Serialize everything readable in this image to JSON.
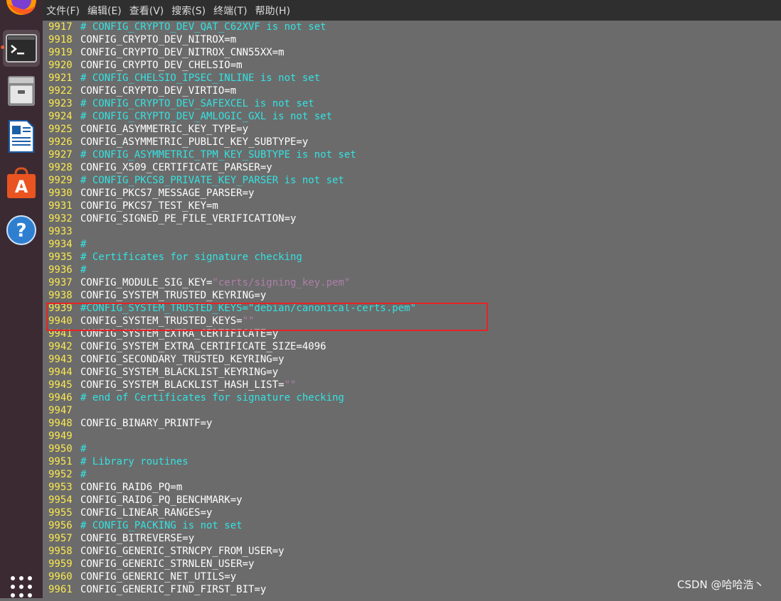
{
  "dock": {
    "items": [
      {
        "name": "firefox-icon"
      },
      {
        "name": "terminal-icon"
      },
      {
        "name": "file-cabinet-icon"
      },
      {
        "name": "writer-document-icon"
      },
      {
        "name": "software-store-icon"
      },
      {
        "name": "help-icon"
      },
      {
        "name": "show-applications-icon"
      }
    ],
    "accent": "#e95420",
    "background": "#3c2a33"
  },
  "menubar": {
    "items": [
      "文件(F)",
      "编辑(E)",
      "查看(V)",
      "搜索(S)",
      "终端(T)",
      "帮助(H)"
    ]
  },
  "colors": {
    "background": "#6b6b6b",
    "line_number": "#fce94f",
    "comment": "#34e2e2",
    "string": "#ad7fa8",
    "text": "#ffffff",
    "highlight_box": "#e82323"
  },
  "editor": {
    "lines": [
      {
        "num": "9917",
        "segments": [
          {
            "t": "# CONFIG_CRYPTO_DEV_QAT_C62XVF is not set",
            "c": "comment"
          }
        ]
      },
      {
        "num": "9918",
        "segments": [
          {
            "t": "CONFIG_CRYPTO_DEV_NITROX=m",
            "c": "text"
          }
        ]
      },
      {
        "num": "9919",
        "segments": [
          {
            "t": "CONFIG_CRYPTO_DEV_NITROX_CNN55XX=m",
            "c": "text"
          }
        ]
      },
      {
        "num": "9920",
        "segments": [
          {
            "t": "CONFIG_CRYPTO_DEV_CHELSIO=m",
            "c": "text"
          }
        ]
      },
      {
        "num": "9921",
        "segments": [
          {
            "t": "# CONFIG_CHELSIO_IPSEC_INLINE is not set",
            "c": "comment"
          }
        ]
      },
      {
        "num": "9922",
        "segments": [
          {
            "t": "CONFIG_CRYPTO_DEV_VIRTIO=m",
            "c": "text"
          }
        ]
      },
      {
        "num": "9923",
        "segments": [
          {
            "t": "# CONFIG_CRYPTO_DEV_SAFEXCEL is not set",
            "c": "comment"
          }
        ]
      },
      {
        "num": "9924",
        "segments": [
          {
            "t": "# CONFIG_CRYPTO_DEV_AMLOGIC_GXL is not set",
            "c": "comment"
          }
        ]
      },
      {
        "num": "9925",
        "segments": [
          {
            "t": "CONFIG_ASYMMETRIC_KEY_TYPE=y",
            "c": "text"
          }
        ]
      },
      {
        "num": "9926",
        "segments": [
          {
            "t": "CONFIG_ASYMMETRIC_PUBLIC_KEY_SUBTYPE=y",
            "c": "text"
          }
        ]
      },
      {
        "num": "9927",
        "segments": [
          {
            "t": "# CONFIG_ASYMMETRIC_TPM_KEY_SUBTYPE is not set",
            "c": "comment"
          }
        ]
      },
      {
        "num": "9928",
        "segments": [
          {
            "t": "CONFIG_X509_CERTIFICATE_PARSER=y",
            "c": "text"
          }
        ]
      },
      {
        "num": "9929",
        "segments": [
          {
            "t": "# CONFIG_PKCS8_PRIVATE_KEY_PARSER is not set",
            "c": "comment"
          }
        ]
      },
      {
        "num": "9930",
        "segments": [
          {
            "t": "CONFIG_PKCS7_MESSAGE_PARSER=y",
            "c": "text"
          }
        ]
      },
      {
        "num": "9931",
        "segments": [
          {
            "t": "CONFIG_PKCS7_TEST_KEY=m",
            "c": "text"
          }
        ]
      },
      {
        "num": "9932",
        "segments": [
          {
            "t": "CONFIG_SIGNED_PE_FILE_VERIFICATION=y",
            "c": "text"
          }
        ]
      },
      {
        "num": "9933",
        "segments": []
      },
      {
        "num": "9934",
        "segments": [
          {
            "t": "#",
            "c": "comment"
          }
        ]
      },
      {
        "num": "9935",
        "segments": [
          {
            "t": "# Certificates for signature checking",
            "c": "comment"
          }
        ]
      },
      {
        "num": "9936",
        "segments": [
          {
            "t": "#",
            "c": "comment"
          }
        ]
      },
      {
        "num": "9937",
        "segments": [
          {
            "t": "CONFIG_MODULE_SIG_KEY=",
            "c": "text"
          },
          {
            "t": "\"certs/signing_key.pem\"",
            "c": "string"
          }
        ]
      },
      {
        "num": "9938",
        "segments": [
          {
            "t": "CONFIG_SYSTEM_TRUSTED_KEYRING=y",
            "c": "text"
          }
        ]
      },
      {
        "num": "9939",
        "segments": [
          {
            "t": "#CONFIG_SYSTEM_TRUSTED_KEYS=\"debian/canonical-certs.pem\"",
            "c": "comment"
          }
        ]
      },
      {
        "num": "9940",
        "segments": [
          {
            "t": "CONFIG_SYSTEM_TRUSTED_KEYS=",
            "c": "text"
          },
          {
            "t": "\"\"",
            "c": "string"
          }
        ]
      },
      {
        "num": "9941",
        "segments": [
          {
            "t": "CONFIG_SYSTEM_EXTRA_CERTIFICATE=y",
            "c": "text"
          }
        ]
      },
      {
        "num": "9942",
        "segments": [
          {
            "t": "CONFIG_SYSTEM_EXTRA_CERTIFICATE_SIZE=4096",
            "c": "text"
          }
        ]
      },
      {
        "num": "9943",
        "segments": [
          {
            "t": "CONFIG_SECONDARY_TRUSTED_KEYRING=y",
            "c": "text"
          }
        ]
      },
      {
        "num": "9944",
        "segments": [
          {
            "t": "CONFIG_SYSTEM_BLACKLIST_KEYRING=y",
            "c": "text"
          }
        ]
      },
      {
        "num": "9945",
        "segments": [
          {
            "t": "CONFIG_SYSTEM_BLACKLIST_HASH_LIST=",
            "c": "text"
          },
          {
            "t": "\"\"",
            "c": "string"
          }
        ]
      },
      {
        "num": "9946",
        "segments": [
          {
            "t": "# end of Certificates for signature checking",
            "c": "comment"
          }
        ]
      },
      {
        "num": "9947",
        "segments": []
      },
      {
        "num": "9948",
        "segments": [
          {
            "t": "CONFIG_BINARY_PRINTF=y",
            "c": "text"
          }
        ]
      },
      {
        "num": "9949",
        "segments": []
      },
      {
        "num": "9950",
        "segments": [
          {
            "t": "#",
            "c": "comment"
          }
        ]
      },
      {
        "num": "9951",
        "segments": [
          {
            "t": "# Library routines",
            "c": "comment"
          }
        ]
      },
      {
        "num": "9952",
        "segments": [
          {
            "t": "#",
            "c": "comment"
          }
        ]
      },
      {
        "num": "9953",
        "segments": [
          {
            "t": "CONFIG_RAID6_PQ=m",
            "c": "text"
          }
        ]
      },
      {
        "num": "9954",
        "segments": [
          {
            "t": "CONFIG_RAID6_PQ_BENCHMARK=y",
            "c": "text"
          }
        ]
      },
      {
        "num": "9955",
        "segments": [
          {
            "t": "CONFIG_LINEAR_RANGES=y",
            "c": "text"
          }
        ]
      },
      {
        "num": "9956",
        "segments": [
          {
            "t": "# CONFIG_PACKING is not set",
            "c": "comment"
          }
        ]
      },
      {
        "num": "9957",
        "segments": [
          {
            "t": "CONFIG_BITREVERSE=y",
            "c": "text"
          }
        ]
      },
      {
        "num": "9958",
        "segments": [
          {
            "t": "CONFIG_GENERIC_STRNCPY_FROM_USER=y",
            "c": "text"
          }
        ]
      },
      {
        "num": "9959",
        "segments": [
          {
            "t": "CONFIG_GENERIC_STRNLEN_USER=y",
            "c": "text"
          }
        ]
      },
      {
        "num": "9960",
        "segments": [
          {
            "t": "CONFIG_GENERIC_NET_UTILS=y",
            "c": "text"
          }
        ]
      },
      {
        "num": "9961",
        "segments": [
          {
            "t": "CONFIG_GENERIC_FIND_FIRST_BIT=y",
            "c": "text"
          }
        ]
      }
    ]
  },
  "watermark": "CSDN @哈哈浩丶"
}
